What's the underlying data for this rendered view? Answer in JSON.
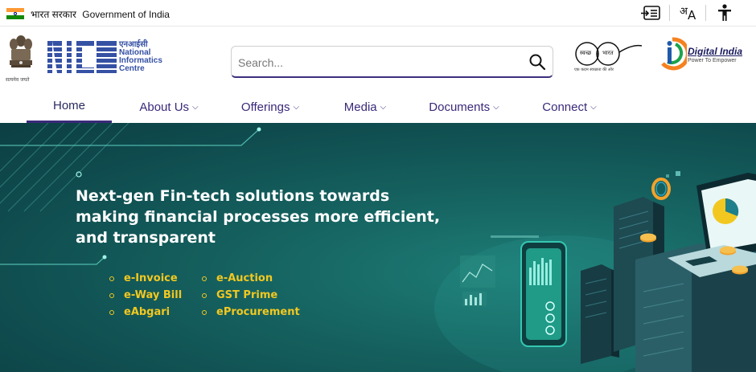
{
  "gov": {
    "hindi": "भारत सरकार",
    "english": "Government of India",
    "flag_colors": [
      "#ff9933",
      "#ffffff",
      "#138808"
    ]
  },
  "utilities": {
    "skip_icon": "skip-to-content-icon",
    "language_icon": "language-icon",
    "language_label_hi": "अ",
    "language_label_en": "A",
    "accessibility_icon": "accessibility-icon"
  },
  "header": {
    "emblem_caption": "सत्यमेव जयते",
    "nic_abbr": "NIC",
    "nic_hindi": "एनआईसी",
    "nic_lines": [
      "National",
      "Informatics",
      "Centre"
    ],
    "search_placeholder": "Search...",
    "swachh_word1": "स्वच्छ",
    "swachh_word2": "भारत",
    "swachh_tag": "एक कदम स्वच्छता की ओर",
    "digital_india_title": "Digital India",
    "digital_india_tag": "Power To Empower",
    "brand_color": "#3d2e7c"
  },
  "nav": {
    "items": [
      {
        "label": "Home",
        "active": true
      },
      {
        "label": "About Us",
        "chevron": "⌵"
      },
      {
        "label": "Offerings",
        "chevron": "⌵"
      },
      {
        "label": "Media",
        "chevron": "⌵"
      },
      {
        "label": "Documents",
        "chevron": "⌵"
      },
      {
        "label": "Connect",
        "chevron": "⌵"
      }
    ]
  },
  "hero": {
    "title_lines": [
      "Next-gen Fin-tech solutions towards",
      "making financial processes more efficient,",
      "and transparent"
    ],
    "col1": [
      "e-Invoice",
      "e-Way Bill",
      "eAbgari"
    ],
    "col2": [
      "e-Auction",
      "GST Prime",
      "eProcurement"
    ],
    "accent_color": "#f2c820"
  }
}
